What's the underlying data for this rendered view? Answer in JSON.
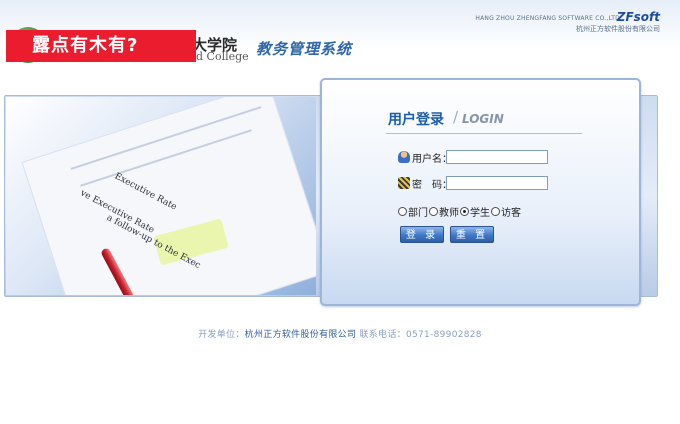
{
  "header": {
    "college_name_cn": "大学院",
    "college_name_en": "d College",
    "system_title": "教务管理系统",
    "overlay_banner": "露点有木有?",
    "vendor_name_en": "HANG ZHOU ZHENGFANG SOFTWARE CO.,LTD.",
    "vendor_logo": "ZFsoft",
    "vendor_name_cn": "杭州正方软件股份有限公司"
  },
  "photo": {
    "text_lines": [
      "Executive Rate",
      "ve Executive Rate",
      "a follow-up to the Exec"
    ]
  },
  "login": {
    "title": "用户登录",
    "separator": "/",
    "title_en": "LOGIN",
    "username_label": "用户名：",
    "username_value": "",
    "password_label": "密　码：",
    "password_value": "",
    "roles": [
      {
        "label": "部门",
        "checked": false
      },
      {
        "label": "教师",
        "checked": false
      },
      {
        "label": "学生",
        "checked": true
      },
      {
        "label": "访客",
        "checked": false
      }
    ],
    "submit_label": "登 录",
    "reset_label": "重 置"
  },
  "footer": {
    "developer_label": "开发单位：",
    "developer_company": "杭州正方软件股份有限公司",
    "phone_label": "联系电话：",
    "phone": "0571-89902828"
  }
}
